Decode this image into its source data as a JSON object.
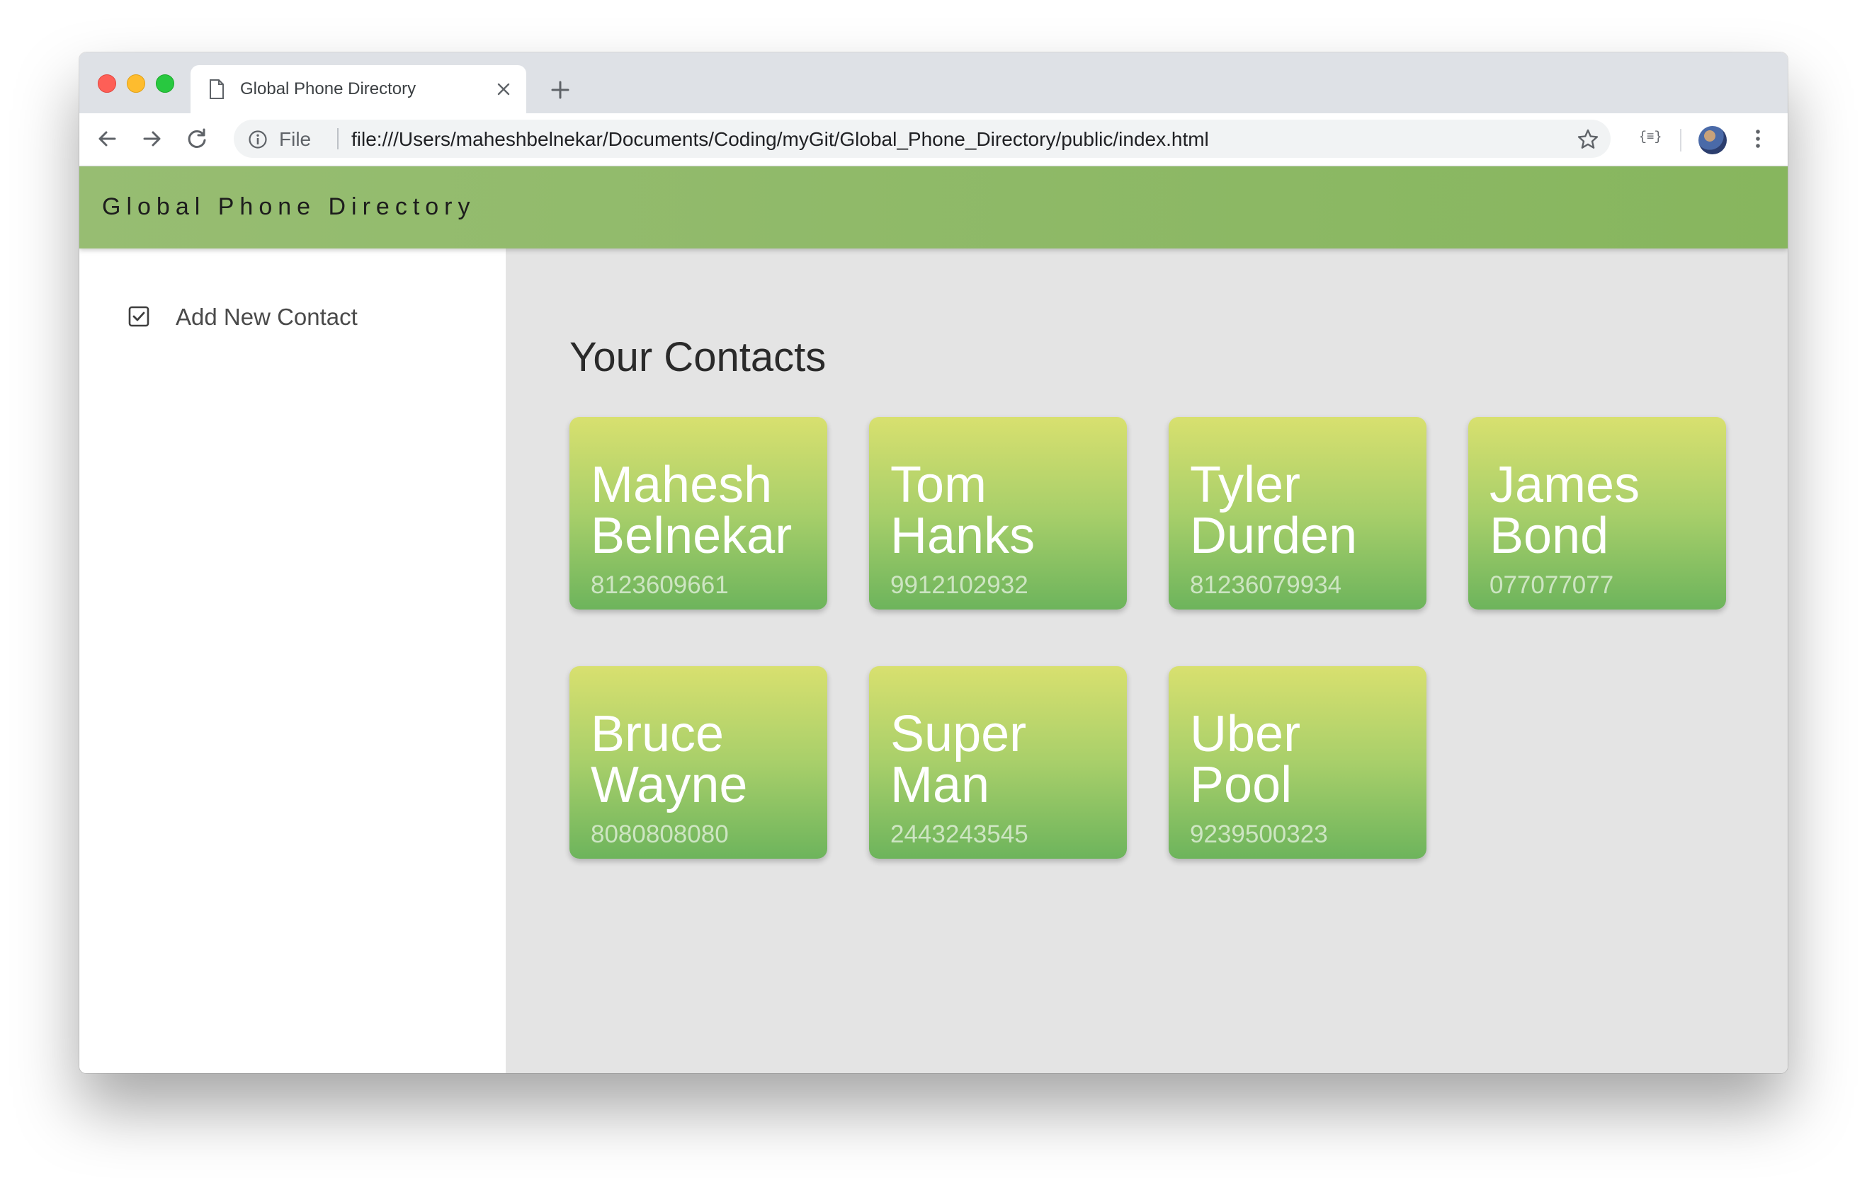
{
  "browser": {
    "tab_title": "Global Phone Directory",
    "scheme_label": "File",
    "url": "file:///Users/maheshbelnekar/Documents/Coding/myGit/Global_Phone_Directory/public/index.html",
    "extension_label": "{≡}"
  },
  "app": {
    "brand": "Global Phone Directory",
    "sidebar": {
      "items": [
        {
          "label": "Add New Contact",
          "icon": "checkbox-icon"
        }
      ]
    },
    "main": {
      "title": "Your Contacts",
      "contacts": [
        {
          "first": "Mahesh",
          "last": "Belnekar",
          "phone": "8123609661"
        },
        {
          "first": "Tom",
          "last": "Hanks",
          "phone": "9912102932"
        },
        {
          "first": "Tyler",
          "last": "Durden",
          "phone": "81236079934"
        },
        {
          "first": "James",
          "last": "Bond",
          "phone": "077077077"
        },
        {
          "first": "Bruce",
          "last": "Wayne",
          "phone": "8080808080"
        },
        {
          "first": "Super",
          "last": "Man",
          "phone": "2443243545"
        },
        {
          "first": "Uber",
          "last": "Pool",
          "phone": "9239500323"
        }
      ]
    }
  },
  "colors": {
    "header_green": "#8fba68",
    "card_top": "#d8e06f",
    "card_bottom": "#6db45c",
    "main_bg": "#e4e4e4"
  }
}
